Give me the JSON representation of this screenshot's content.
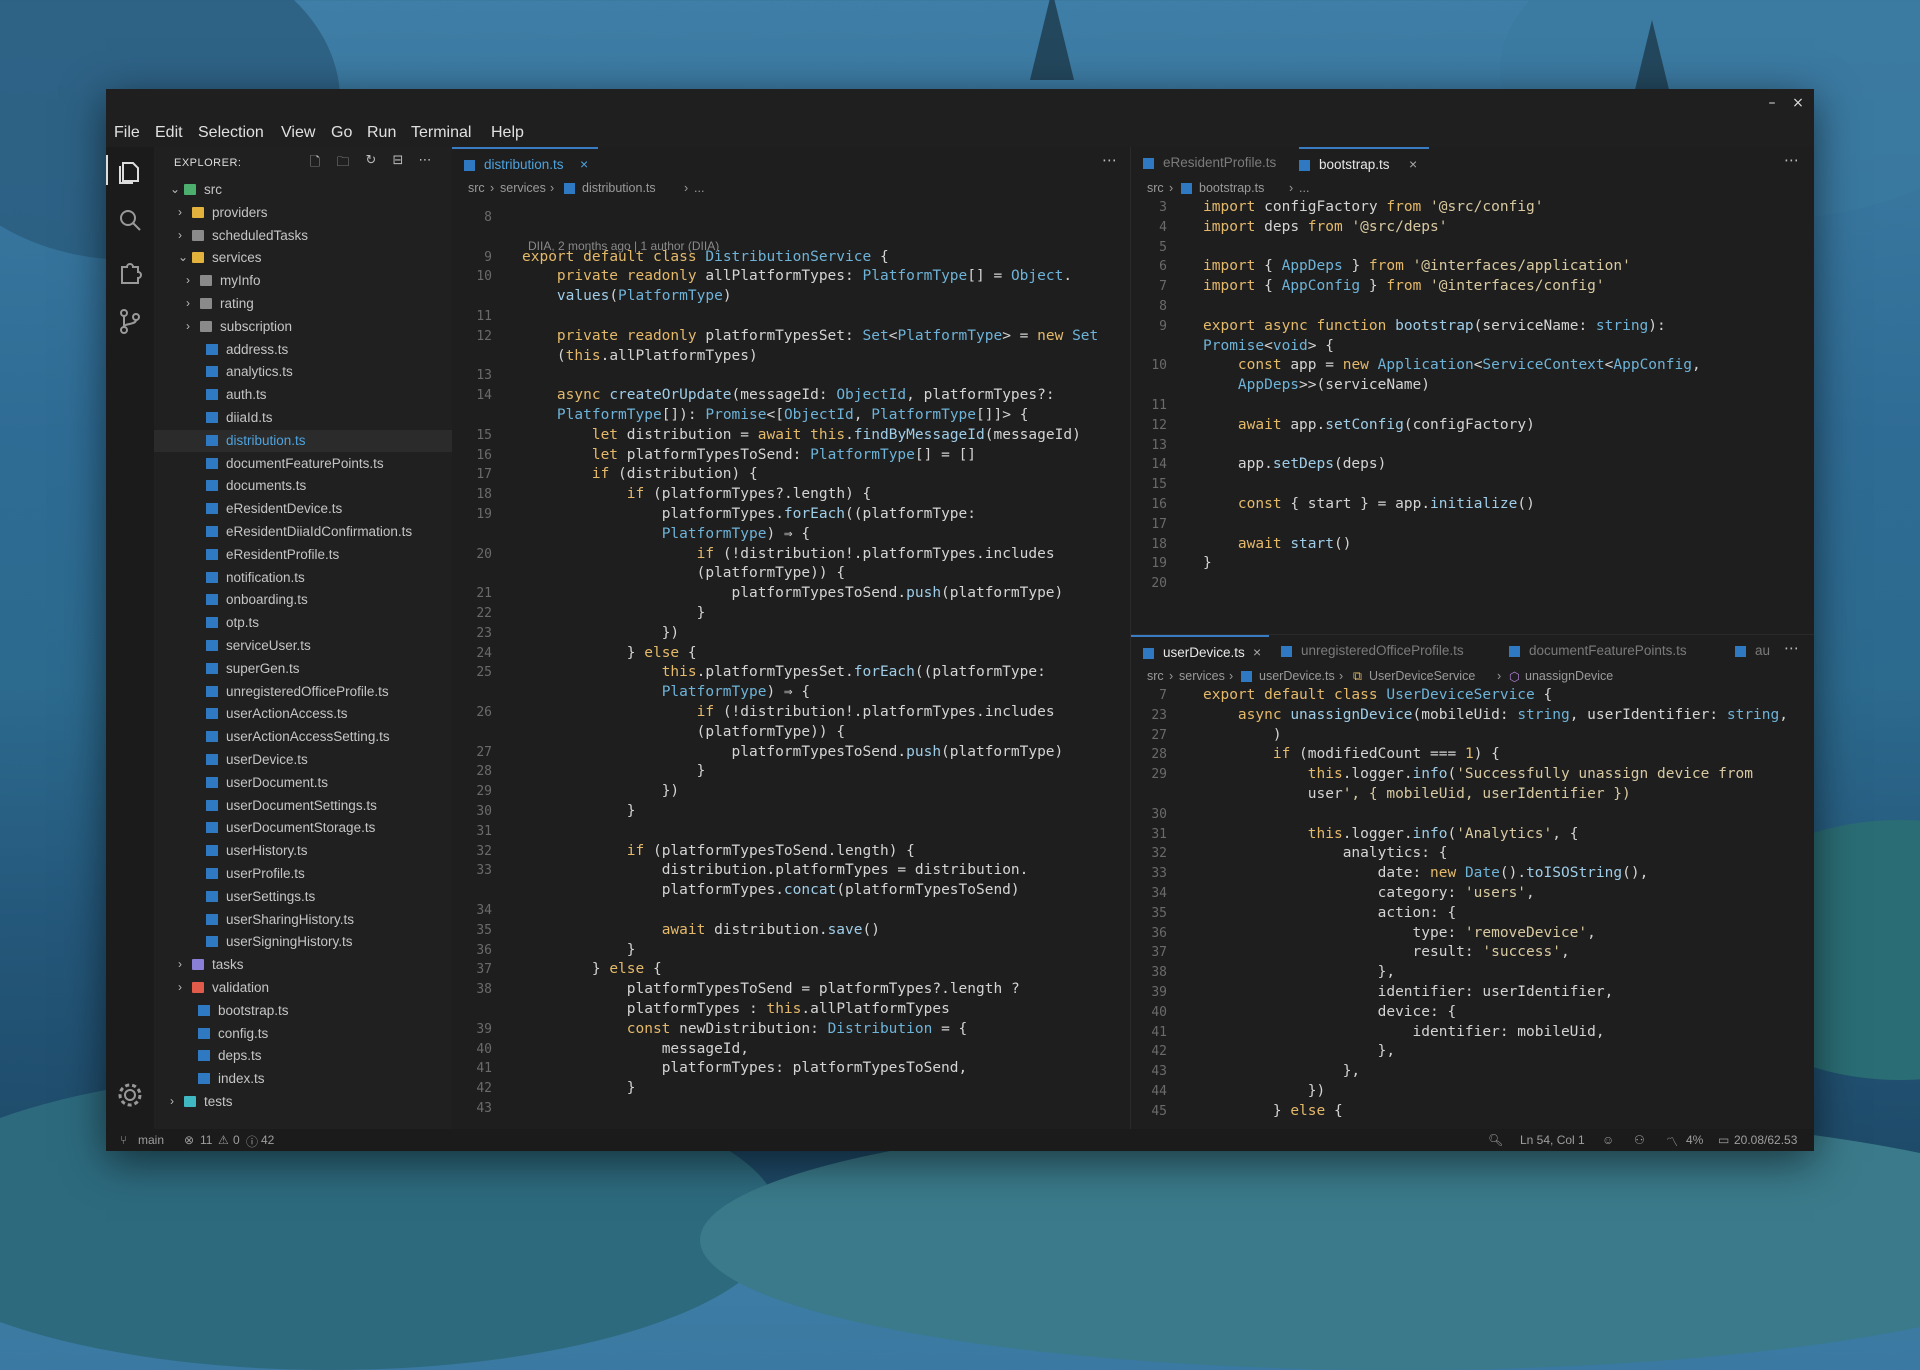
{
  "menu": [
    "File",
    "Edit",
    "Selection",
    "View",
    "Go",
    "Run",
    "Terminal",
    "Help"
  ],
  "window_controls": {
    "minimize": "–",
    "close": "×"
  },
  "explorer": {
    "title": "EXPLORER:",
    "items": [
      {
        "label": "src",
        "type": "folder-open",
        "depth": 0
      },
      {
        "label": "providers",
        "type": "folder",
        "depth": 1
      },
      {
        "label": "scheduledTasks",
        "type": "folder",
        "depth": 1
      },
      {
        "label": "services",
        "type": "folder-open",
        "depth": 1
      },
      {
        "label": "myInfo",
        "type": "folder",
        "depth": 2
      },
      {
        "label": "rating",
        "type": "folder",
        "depth": 2
      },
      {
        "label": "subscription",
        "type": "folder",
        "depth": 2
      },
      {
        "label": "address.ts",
        "type": "file",
        "depth": 2
      },
      {
        "label": "analytics.ts",
        "type": "file",
        "depth": 2
      },
      {
        "label": "auth.ts",
        "type": "file",
        "depth": 2
      },
      {
        "label": "diiaId.ts",
        "type": "file",
        "depth": 2
      },
      {
        "label": "distribution.ts",
        "type": "file",
        "depth": 2,
        "selected": true
      },
      {
        "label": "documentFeaturePoints.ts",
        "type": "file",
        "depth": 2
      },
      {
        "label": "documents.ts",
        "type": "file",
        "depth": 2
      },
      {
        "label": "eResidentDevice.ts",
        "type": "file",
        "depth": 2
      },
      {
        "label": "eResidentDiiaIdConfirmation.ts",
        "type": "file",
        "depth": 2
      },
      {
        "label": "eResidentProfile.ts",
        "type": "file",
        "depth": 2
      },
      {
        "label": "notification.ts",
        "type": "file",
        "depth": 2
      },
      {
        "label": "onboarding.ts",
        "type": "file",
        "depth": 2
      },
      {
        "label": "otp.ts",
        "type": "file",
        "depth": 2
      },
      {
        "label": "serviceUser.ts",
        "type": "file",
        "depth": 2
      },
      {
        "label": "superGen.ts",
        "type": "file",
        "depth": 2
      },
      {
        "label": "unregisteredOfficeProfile.ts",
        "type": "file",
        "depth": 2
      },
      {
        "label": "userActionAccess.ts",
        "type": "file",
        "depth": 2
      },
      {
        "label": "userActionAccessSetting.ts",
        "type": "file",
        "depth": 2
      },
      {
        "label": "userDevice.ts",
        "type": "file",
        "depth": 2
      },
      {
        "label": "userDocument.ts",
        "type": "file",
        "depth": 2
      },
      {
        "label": "userDocumentSettings.ts",
        "type": "file",
        "depth": 2
      },
      {
        "label": "userDocumentStorage.ts",
        "type": "file",
        "depth": 2
      },
      {
        "label": "userHistory.ts",
        "type": "file",
        "depth": 2
      },
      {
        "label": "userProfile.ts",
        "type": "file",
        "depth": 2
      },
      {
        "label": "userSettings.ts",
        "type": "file",
        "depth": 2
      },
      {
        "label": "userSharingHistory.ts",
        "type": "file",
        "depth": 2
      },
      {
        "label": "userSigningHistory.ts",
        "type": "file",
        "depth": 2
      },
      {
        "label": "tasks",
        "type": "folder",
        "depth": 1
      },
      {
        "label": "validation",
        "type": "folder",
        "depth": 1
      },
      {
        "label": "bootstrap.ts",
        "type": "file",
        "depth": 1
      },
      {
        "label": "config.ts",
        "type": "file",
        "depth": 1
      },
      {
        "label": "deps.ts",
        "type": "file",
        "depth": 1
      },
      {
        "label": "index.ts",
        "type": "file",
        "depth": 1
      },
      {
        "label": "tests",
        "type": "folder",
        "depth": 0
      }
    ]
  },
  "left_editor": {
    "tab": "distribution.ts",
    "breadcrumb": [
      "src",
      "services",
      "distribution.ts",
      "..."
    ],
    "blame": "DIIA, 2 months ago | 1 author (DIIA)",
    "lines": [
      [
        "8",
        ""
      ],
      [
        "",
        ""
      ],
      [
        "9",
        "export default class DistributionService {"
      ],
      [
        "10",
        "    private readonly allPlatformTypes: PlatformType[] = Object."
      ],
      [
        "",
        "    values(PlatformType)"
      ],
      [
        "11",
        ""
      ],
      [
        "12",
        "    private readonly platformTypesSet: Set<PlatformType> = new Set"
      ],
      [
        "",
        "    (this.allPlatformTypes)"
      ],
      [
        "13",
        ""
      ],
      [
        "14",
        "    async createOrUpdate(messageId: ObjectId, platformTypes?:"
      ],
      [
        "",
        "    PlatformType[]): Promise<[ObjectId, PlatformType[]]> {"
      ],
      [
        "15",
        "        let distribution = await this.findByMessageId(messageId)"
      ],
      [
        "16",
        "        let platformTypesToSend: PlatformType[] = []"
      ],
      [
        "17",
        "        if (distribution) {"
      ],
      [
        "18",
        "            if (platformTypes?.length) {"
      ],
      [
        "19",
        "                platformTypes.forEach((platformType:"
      ],
      [
        "",
        "                PlatformType) ⇒ {"
      ],
      [
        "20",
        "                    if (!distribution!.platformTypes.includes"
      ],
      [
        "",
        "                    (platformType)) {"
      ],
      [
        "21",
        "                        platformTypesToSend.push(platformType)"
      ],
      [
        "22",
        "                    }"
      ],
      [
        "23",
        "                })"
      ],
      [
        "24",
        "            } else {"
      ],
      [
        "25",
        "                this.platformTypesSet.forEach((platformType:"
      ],
      [
        "",
        "                PlatformType) ⇒ {"
      ],
      [
        "26",
        "                    if (!distribution!.platformTypes.includes"
      ],
      [
        "",
        "                    (platformType)) {"
      ],
      [
        "27",
        "                        platformTypesToSend.push(platformType)"
      ],
      [
        "28",
        "                    }"
      ],
      [
        "29",
        "                })"
      ],
      [
        "30",
        "            }"
      ],
      [
        "31",
        ""
      ],
      [
        "32",
        "            if (platformTypesToSend.length) {"
      ],
      [
        "33",
        "                distribution.platformTypes = distribution."
      ],
      [
        "",
        "                platformTypes.concat(platformTypesToSend)"
      ],
      [
        "34",
        ""
      ],
      [
        "35",
        "                await distribution.save()"
      ],
      [
        "36",
        "            }"
      ],
      [
        "37",
        "        } else {"
      ],
      [
        "38",
        "            platformTypesToSend = platformTypes?.length ?"
      ],
      [
        "",
        "            platformTypes : this.allPlatformTypes"
      ],
      [
        "39",
        "            const newDistribution: Distribution = {"
      ],
      [
        "40",
        "                messageId,"
      ],
      [
        "41",
        "                platformTypes: platformTypesToSend,"
      ],
      [
        "42",
        "            }"
      ],
      [
        "43",
        ""
      ]
    ]
  },
  "right_top_editor": {
    "tabs": [
      {
        "label": "eResidentProfile.ts",
        "active": false
      },
      {
        "label": "bootstrap.ts",
        "active": true
      }
    ],
    "breadcrumb": [
      "src",
      "bootstrap.ts",
      "..."
    ],
    "lines": [
      [
        "3",
        "import configFactory from '@src/config'"
      ],
      [
        "4",
        "import deps from '@src/deps'"
      ],
      [
        "5",
        ""
      ],
      [
        "6",
        "import { AppDeps } from '@interfaces/application'"
      ],
      [
        "7",
        "import { AppConfig } from '@interfaces/config'"
      ],
      [
        "8",
        ""
      ],
      [
        "9",
        "export async function bootstrap(serviceName: string):"
      ],
      [
        "",
        "Promise<void> {"
      ],
      [
        "10",
        "    const app = new Application<ServiceContext<AppConfig,"
      ],
      [
        "",
        "    AppDeps>>(serviceName)"
      ],
      [
        "11",
        ""
      ],
      [
        "12",
        "    await app.setConfig(configFactory)"
      ],
      [
        "13",
        ""
      ],
      [
        "14",
        "    app.setDeps(deps)"
      ],
      [
        "15",
        ""
      ],
      [
        "16",
        "    const { start } = app.initialize()"
      ],
      [
        "17",
        ""
      ],
      [
        "18",
        "    await start()"
      ],
      [
        "19",
        "}"
      ],
      [
        "20",
        ""
      ]
    ]
  },
  "right_bottom_editor": {
    "tabs": [
      {
        "label": "userDevice.ts",
        "active": true
      },
      {
        "label": "unregisteredOfficeProfile.ts",
        "active": false
      },
      {
        "label": "documentFeaturePoints.ts",
        "active": false
      },
      {
        "label": "au",
        "active": false
      }
    ],
    "breadcrumb": [
      "src",
      "services",
      "userDevice.ts",
      "UserDeviceService",
      "unassignDevice"
    ],
    "lines": [
      [
        "7",
        "export default class UserDeviceService {"
      ],
      [
        "23",
        "    async unassignDevice(mobileUid: string, userIdentifier: string,"
      ],
      [
        "27",
        "        )"
      ],
      [
        "28",
        "        if (modifiedCount === 1) {"
      ],
      [
        "29",
        "            this.logger.info('Successfully unassign device from"
      ],
      [
        "",
        "            user', { mobileUid, userIdentifier })"
      ],
      [
        "30",
        ""
      ],
      [
        "31",
        "            this.logger.info('Analytics', {"
      ],
      [
        "32",
        "                analytics: {"
      ],
      [
        "33",
        "                    date: new Date().toISOString(),"
      ],
      [
        "34",
        "                    category: 'users',"
      ],
      [
        "35",
        "                    action: {"
      ],
      [
        "36",
        "                        type: 'removeDevice',"
      ],
      [
        "37",
        "                        result: 'success',"
      ],
      [
        "38",
        "                    },"
      ],
      [
        "39",
        "                    identifier: userIdentifier,"
      ],
      [
        "40",
        "                    device: {"
      ],
      [
        "41",
        "                        identifier: mobileUid,"
      ],
      [
        "42",
        "                    },"
      ],
      [
        "43",
        "                },"
      ],
      [
        "44",
        "            })"
      ],
      [
        "45",
        "        } else {"
      ]
    ]
  },
  "status": {
    "branch": "main",
    "errors": "11",
    "warnings": "0",
    "info": "42",
    "position": "Ln 54, Col 1",
    "cpu": "4%",
    "memory": "20.08/62.53"
  },
  "colors": {
    "keyword": "#e5b96a",
    "type": "#6eb3d8",
    "ts_icon": "#2f79c2",
    "background": "#1e1e1e"
  }
}
